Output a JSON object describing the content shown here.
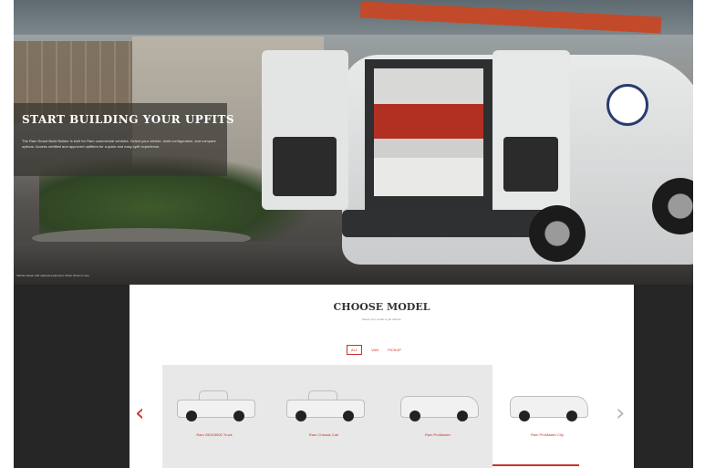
{
  "hero": {
    "title": "START BUILDING YOUR UPFITS",
    "description": "The Ram Smart Build Builder is built for Ram commercial vehicles. Select your vehicle, build configuration, and compare options. Access certified and approved upfitters for a quick and easy upfit experience.",
    "caption": "Vehicle shown with optional equipment. Photo shown in van."
  },
  "choose_model": {
    "title": "CHOOSE MODEL",
    "subtitle": "Select your model to get started."
  },
  "filters": [
    {
      "label": "ALL",
      "active": true
    },
    {
      "label": "VAN",
      "active": false
    },
    {
      "label": "PICKUP",
      "active": false
    }
  ],
  "carousel": {
    "prev_icon": "chevron-left-icon",
    "next_icon": "chevron-right-icon",
    "prev_glyph": "‹",
    "next_glyph": "›",
    "models": [
      {
        "label": "Ram 2500/3500 Truck",
        "vehicle_icon": "pickup-truck-icon"
      },
      {
        "label": "Ram Chassis Cab",
        "vehicle_icon": "chassis-cab-icon"
      },
      {
        "label": "Ram ProMaster",
        "vehicle_icon": "cargo-van-icon"
      },
      {
        "label": "Ram ProMaster City",
        "vehicle_icon": "compact-van-icon"
      }
    ]
  },
  "colors": {
    "accent": "#c8342a",
    "dark_bg": "#262626",
    "carousel_bg": "#e8e8e8"
  }
}
